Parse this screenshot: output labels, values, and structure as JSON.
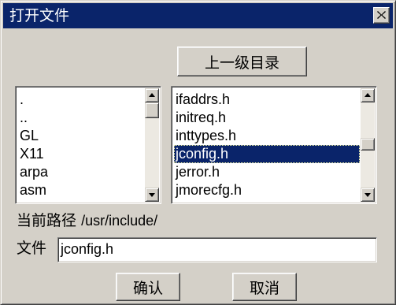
{
  "window": {
    "title": "打开文件"
  },
  "toolbar": {
    "parent_dir_label": "上一级目录"
  },
  "dir_list": {
    "items": [
      ".",
      "..",
      "GL",
      "X11",
      "arpa",
      "asm"
    ]
  },
  "file_list": {
    "items": [
      "ifaddrs.h",
      "initreq.h",
      "inttypes.h",
      "jconfig.h",
      "jerror.h",
      "jmorecfg.h"
    ],
    "selected": "jconfig.h"
  },
  "path": {
    "label": "当前路径",
    "value": "/usr/include/"
  },
  "file": {
    "label": "文件",
    "value": "jconfig.h"
  },
  "buttons": {
    "ok_label": "确认",
    "cancel_label": "取消"
  },
  "icons": {
    "close": "close-icon",
    "scroll_up": "arrow-up-icon",
    "scroll_down": "arrow-down-icon"
  },
  "colors": {
    "titlebar": "#0a246a",
    "selection": "#0a246a",
    "face": "#d4d0c8"
  }
}
